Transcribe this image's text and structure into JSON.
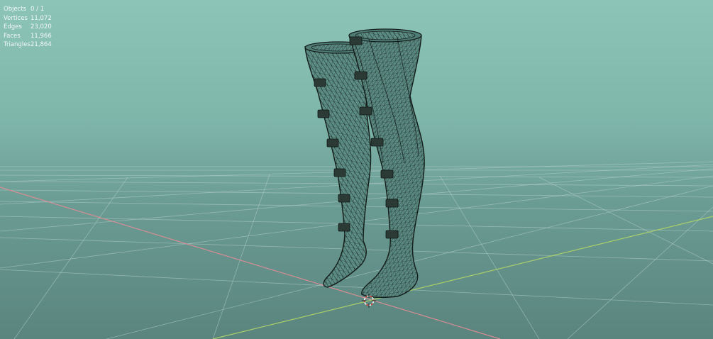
{
  "viewport": {
    "background_top": "#8cc5b8",
    "background_bottom": "#5a847e",
    "grid_color": "#b9d3cd",
    "x_axis_color": "#d78c95",
    "y_axis_color": "#a9cf6a",
    "mesh_wire_color": "#16211e",
    "mesh_fill_color": "#57877f",
    "strap_color": "#2c3a36",
    "cursor_colors": [
      "#d9413a",
      "#f2f2f2"
    ]
  },
  "stats": [
    {
      "label": "Objects",
      "value": "0 / 1"
    },
    {
      "label": "Vertices",
      "value": "11,072"
    },
    {
      "label": "Edges",
      "value": "23,020"
    },
    {
      "label": "Faces",
      "value": "11,966"
    },
    {
      "label": "Triangles",
      "value": "21,864"
    }
  ],
  "scene": {
    "object": "wireframe-stockings-mesh",
    "cursor": "3d-cursor-icon"
  }
}
